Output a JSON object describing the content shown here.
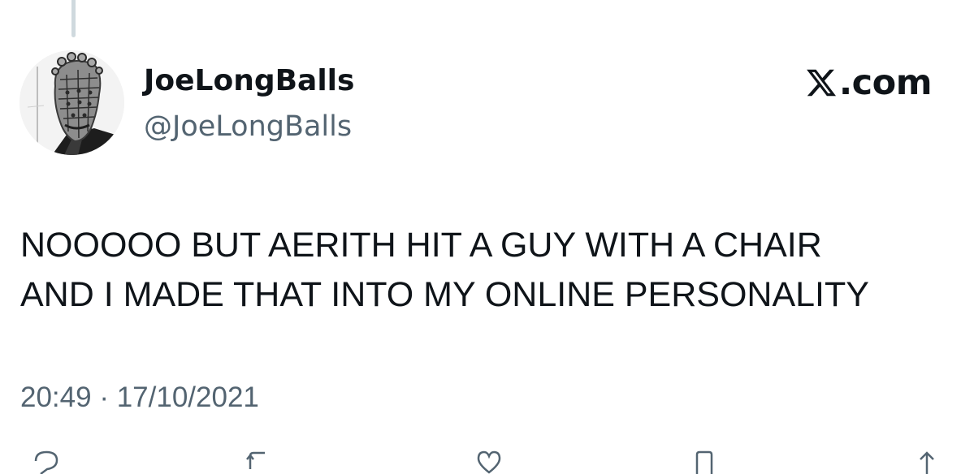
{
  "tweet": {
    "display_name": "JoeLongBalls",
    "handle": "@JoeLongBalls",
    "text_lines": [
      "NOOOOO BUT AERITH HIT A GUY WITH A CHAIR",
      "AND I MADE THAT INTO MY ONLINE PERSONALITY"
    ],
    "time": "20:49",
    "separator": "·",
    "date": "17/10/2021"
  },
  "brand": {
    "logo_icon": "x-logo-icon",
    "domain": ".com"
  },
  "actions": [
    {
      "icon": "reply-icon"
    },
    {
      "icon": "retweet-icon"
    },
    {
      "icon": "like-icon"
    },
    {
      "icon": "bookmark-icon"
    },
    {
      "icon": "share-icon"
    }
  ],
  "colors": {
    "text_primary": "#0f1419",
    "text_secondary": "#536471",
    "thread_line": "#cfd9de",
    "background": "#ffffff"
  }
}
